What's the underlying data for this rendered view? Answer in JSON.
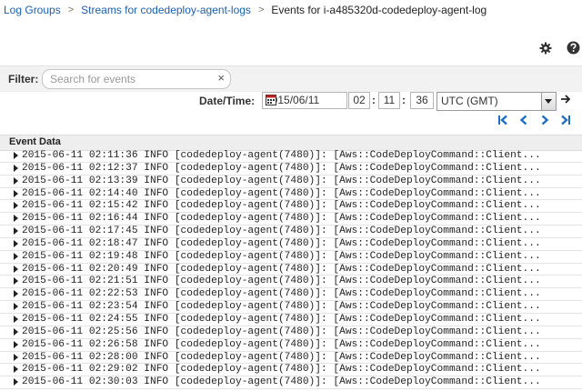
{
  "breadcrumb": {
    "log_groups": "Log Groups",
    "streams": "Streams for codedeploy-agent-logs",
    "current": "Events for i-a485320d-codedeploy-agent-log",
    "separator": ">"
  },
  "icons": {
    "settings": "gear-icon",
    "help": "help-icon"
  },
  "filter": {
    "label": "Filter:",
    "placeholder": "Search for events",
    "value": "",
    "clear": "×"
  },
  "datetime": {
    "label": "Date/Time:",
    "date": "2015/06/11",
    "hour": "02",
    "minute": "11",
    "second": "36",
    "timezone": "UTC (GMT)"
  },
  "table": {
    "header": "Event Data",
    "rows": [
      "2015-06-11 02:11:36 INFO [codedeploy-agent(7480)]: [Aws::CodeDeployCommand::Client...",
      "2015-06-11 02:12:37 INFO [codedeploy-agent(7480)]: [Aws::CodeDeployCommand::Client...",
      "2015-06-11 02:13:39 INFO [codedeploy-agent(7480)]: [Aws::CodeDeployCommand::Client...",
      "2015-06-11 02:14:40 INFO [codedeploy-agent(7480)]: [Aws::CodeDeployCommand::Client...",
      "2015-06-11 02:15:42 INFO [codedeploy-agent(7480)]: [Aws::CodeDeployCommand::Client...",
      "2015-06-11 02:16:44 INFO [codedeploy-agent(7480)]: [Aws::CodeDeployCommand::Client...",
      "2015-06-11 02:17:45 INFO [codedeploy-agent(7480)]: [Aws::CodeDeployCommand::Client...",
      "2015-06-11 02:18:47 INFO [codedeploy-agent(7480)]: [Aws::CodeDeployCommand::Client...",
      "2015-06-11 02:19:48 INFO [codedeploy-agent(7480)]: [Aws::CodeDeployCommand::Client...",
      "2015-06-11 02:20:49 INFO [codedeploy-agent(7480)]: [Aws::CodeDeployCommand::Client...",
      "2015-06-11 02:21:51 INFO [codedeploy-agent(7480)]: [Aws::CodeDeployCommand::Client...",
      "2015-06-11 02:22:53 INFO [codedeploy-agent(7480)]: [Aws::CodeDeployCommand::Client...",
      "2015-06-11 02:23:54 INFO [codedeploy-agent(7480)]: [Aws::CodeDeployCommand::Client...",
      "2015-06-11 02:24:55 INFO [codedeploy-agent(7480)]: [Aws::CodeDeployCommand::Client...",
      "2015-06-11 02:25:56 INFO [codedeploy-agent(7480)]: [Aws::CodeDeployCommand::Client...",
      "2015-06-11 02:26:58 INFO [codedeploy-agent(7480)]: [Aws::CodeDeployCommand::Client...",
      "2015-06-11 02:28:00 INFO [codedeploy-agent(7480)]: [Aws::CodeDeployCommand::Client...",
      "2015-06-11 02:29:02 INFO [codedeploy-agent(7480)]: [Aws::CodeDeployCommand::Client...",
      "2015-06-11 02:30:03 INFO [codedeploy-agent(7480)]: [Aws::CodeDeployCommand::Client..."
    ]
  },
  "colors": {
    "link": "#1d5fa8",
    "pager": "#1d6fc4",
    "toolbar_bg": "#f2f2f2",
    "header_bg": "#eeeeee"
  }
}
